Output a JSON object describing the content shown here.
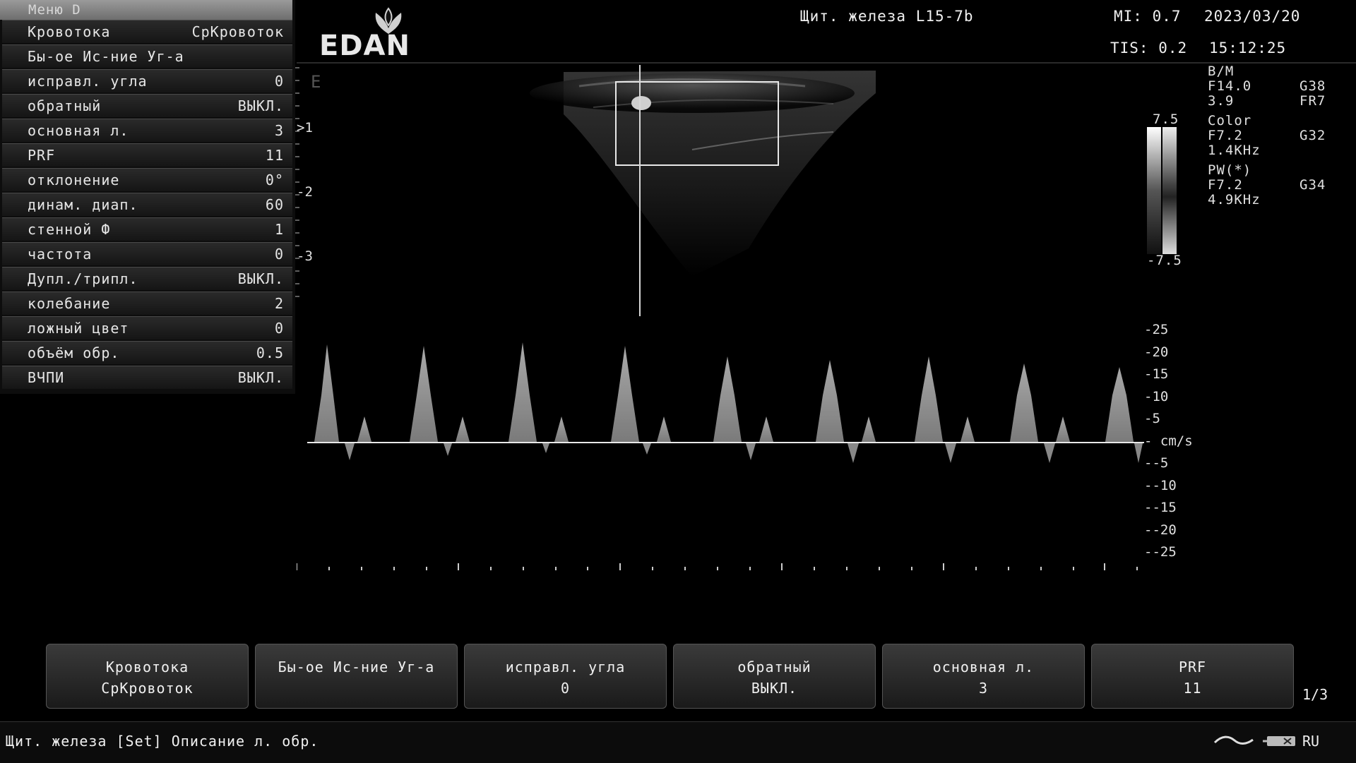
{
  "menu": {
    "title": "Меню D",
    "items": [
      {
        "label": "Кровотока",
        "value": "СрКровоток"
      },
      {
        "label": "Бы-ое Ис-ние Уг-а",
        "value": ""
      },
      {
        "label": "исправл. угла",
        "value": "0"
      },
      {
        "label": "обратный",
        "value": "ВЫКЛ."
      },
      {
        "label": "основная л.",
        "value": "3"
      },
      {
        "label": "PRF",
        "value": "11"
      },
      {
        "label": "отклонение",
        "value": "0°"
      },
      {
        "label": "динам. диап.",
        "value": "60"
      },
      {
        "label": "стенной Ф",
        "value": "1"
      },
      {
        "label": "частота",
        "value": "0"
      },
      {
        "label": "Дупл./трипл.",
        "value": "ВЫКЛ."
      },
      {
        "label": "колебание",
        "value": "2"
      },
      {
        "label": "ложный цвет",
        "value": "0"
      },
      {
        "label": "объём обр.",
        "value": "0.5"
      },
      {
        "label": "ВЧПИ",
        "value": "ВЫКЛ."
      }
    ]
  },
  "header": {
    "logo": "EDAN",
    "exam": "Щит. железа L15-7b",
    "mi": "MI: 0.7",
    "date": "2023/03/20",
    "tis": "TIS: 0.2",
    "time": "15:12:25"
  },
  "params": {
    "bm_title": "B/M",
    "bm_f": "F14.0",
    "bm_g": "G38",
    "bm_depth": "3.9",
    "bm_fr": "FR7",
    "color_title": "Color",
    "color_f": "F7.2",
    "color_g": "G32",
    "color_prf": "1.4KHz",
    "pw_title": "PW(*)",
    "pw_f": "F7.2",
    "pw_g": "G34",
    "pw_prf": "4.9KHz"
  },
  "colorbar": {
    "top": "7.5",
    "bottom": "-7.5"
  },
  "image": {
    "marker": "E",
    "depth_ticks": [
      ">1",
      "-2",
      "-3"
    ]
  },
  "spectrum": {
    "unit_label": "- cm/s",
    "scale_labels": [
      "-25",
      "-20",
      "-15",
      "-10",
      "-5",
      "--5",
      "--10",
      "--15",
      "--20",
      "--25"
    ]
  },
  "buttons": [
    {
      "line1": "Кровотока",
      "line2": "СрКровоток"
    },
    {
      "line1": "Бы-ое Ис-ние Уг-а",
      "line2": ""
    },
    {
      "line1": "исправл. угла",
      "line2": "0"
    },
    {
      "line1": "обратный",
      "line2": "ВЫКЛ."
    },
    {
      "line1": "основная л.",
      "line2": "3"
    },
    {
      "line1": "PRF",
      "line2": "11"
    }
  ],
  "page_indicator": "1/3",
  "status": {
    "text": "Щит. железа [Set] Описание л. обр.",
    "lang": "RU"
  },
  "icons": [
    "edan-logo-icon",
    "probe-icon",
    "keyboard-icon"
  ]
}
